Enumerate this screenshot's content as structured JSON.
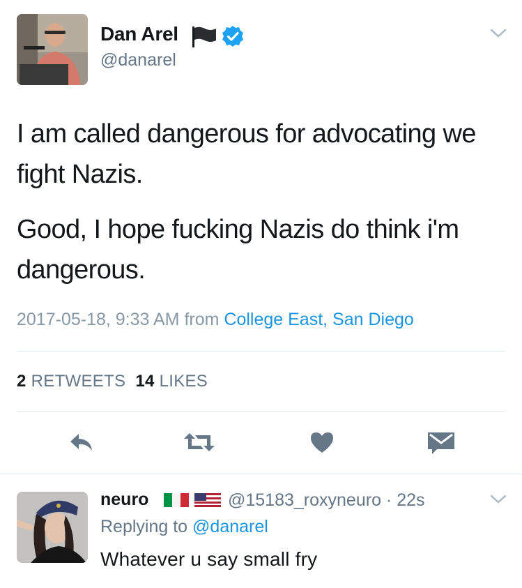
{
  "tweet": {
    "author": {
      "name": "Dan Arel",
      "handle": "@danarel",
      "verified": true,
      "avatar": "avatar-man-at-podium",
      "flag": "black-flag-icon"
    },
    "paragraphs": [
      "I am called dangerous for advocating we fight Nazis.",
      "Good, I hope fucking Nazis do think i'm dangerous."
    ],
    "timestamp": "2017-05-18, 9:33 AM from",
    "location": "College East, San Diego",
    "stats": {
      "retweets_count": "2",
      "retweets_label": "RETWEETS",
      "likes_count": "14",
      "likes_label": "LIKES"
    },
    "actions": [
      "reply-icon",
      "retweet-icon",
      "heart-icon",
      "mail-icon"
    ]
  },
  "reply": {
    "author": {
      "name": "neuro",
      "flags": [
        "italy-flag-icon",
        "usa-flag-icon"
      ],
      "handle_time": "@15183_roxyneuro · 22s",
      "avatar": "avatar-woman"
    },
    "replying_prefix": "Replying to",
    "replying_to": "@danarel",
    "text": "Whatever u say small fry"
  },
  "colors": {
    "text": "#14171a",
    "secondary": "#657786",
    "link": "#1b95e0",
    "icon": "#657786",
    "verified": "#1da1f2",
    "divider": "#e1e8ed"
  }
}
